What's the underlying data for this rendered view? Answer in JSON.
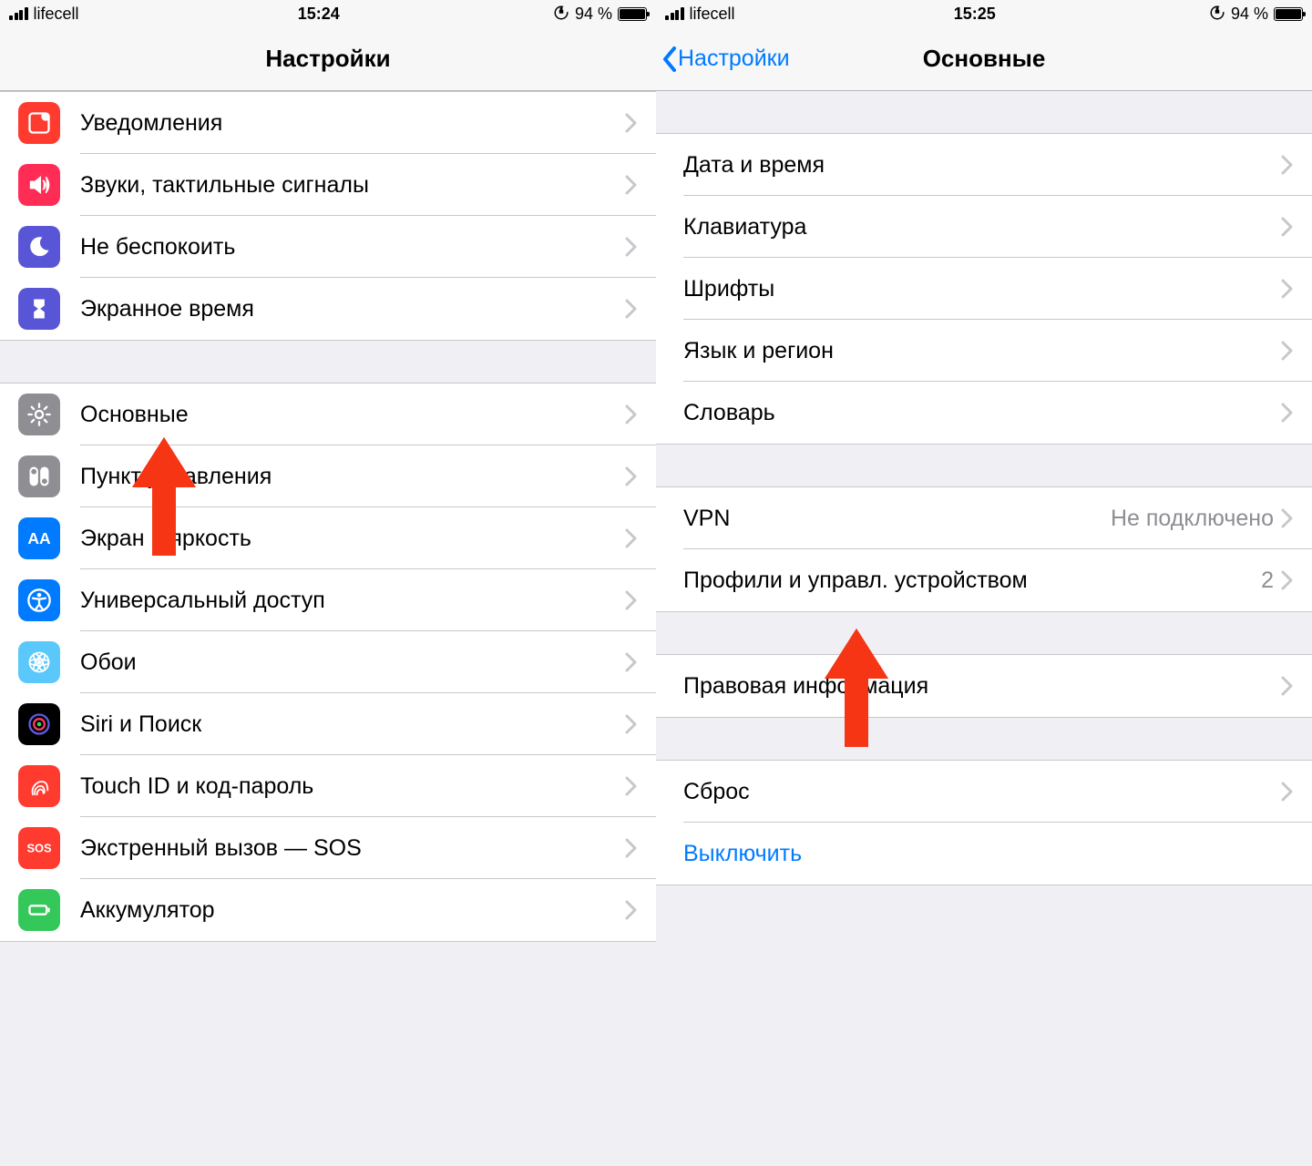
{
  "status": {
    "carrier": "lifecell",
    "time_left": "15:24",
    "time_right": "15:25",
    "battery": "94 %"
  },
  "left": {
    "title": "Настройки",
    "rows": {
      "notifications": "Уведомления",
      "sounds": "Звуки, тактильные сигналы",
      "dnd": "Не беспокоить",
      "screentime": "Экранное время",
      "general": "Основные",
      "controlcenter": "Пункт управления",
      "display": "Экран и яркость",
      "accessibility": "Универсальный доступ",
      "wallpaper": "Обои",
      "siri": "Siri и Поиск",
      "touchid": "Touch ID и код-пароль",
      "sos": "Экстренный вызов — SOS",
      "battery": "Аккумулятор"
    }
  },
  "right": {
    "back": "Настройки",
    "title": "Основные",
    "rows": {
      "datetime": "Дата и время",
      "keyboard": "Клавиатура",
      "fonts": "Шрифты",
      "language": "Язык и регион",
      "dictionary": "Словарь",
      "vpn": "VPN",
      "vpn_value": "Не подключено",
      "profiles": "Профили и управл. устройством",
      "profiles_value": "2",
      "legal": "Правовая информация",
      "reset": "Сброс",
      "shutdown": "Выключить"
    }
  }
}
